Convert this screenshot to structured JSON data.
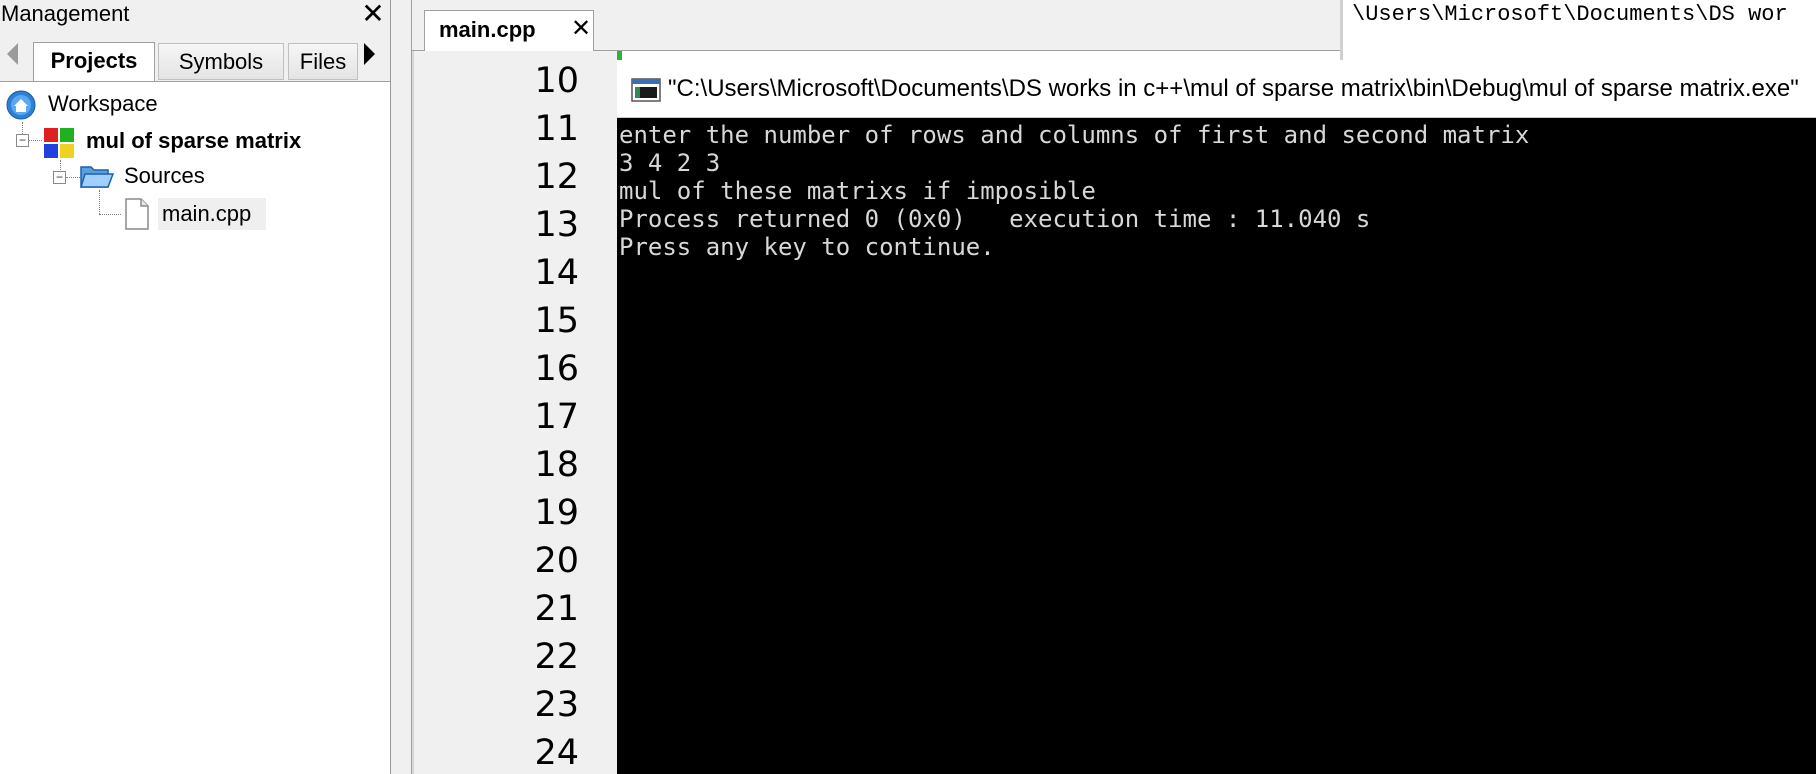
{
  "management": {
    "title": "Management",
    "close_glyph": "✕",
    "tabs": [
      {
        "label": "Projects"
      },
      {
        "label": "Symbols"
      },
      {
        "label": "Files"
      }
    ],
    "tree": {
      "workspace": "Workspace",
      "project": "mul of sparse matrix",
      "folder": "Sources",
      "file": "main.cpp"
    }
  },
  "editor": {
    "tab_label": "main.cpp",
    "tab_close": "✕",
    "line_numbers": [
      "10",
      "11",
      "12",
      "13",
      "14",
      "15",
      "16",
      "17",
      "18",
      "19",
      "20",
      "21",
      "22",
      "23",
      "24"
    ]
  },
  "right_panel": {
    "path_text": "\\Users\\Microsoft\\Documents\\DS wor"
  },
  "console": {
    "title": "\"C:\\Users\\Microsoft\\Documents\\DS works in c++\\mul of sparse matrix\\bin\\Debug\\mul of sparse matrix.exe\"",
    "lines": [
      "enter the number of rows and columns of first and second matrix",
      "3 4 2 3",
      "mul of these matrixs if imposible",
      "Process returned 0 (0x0)   execution time : 11.040 s",
      "Press any key to continue."
    ]
  },
  "colors": {
    "console_bg": "#000000",
    "console_text": "#d8d8d8",
    "gutter_bg": "#f0f0f0",
    "change_bar": "#2fb23b"
  },
  "icons": {
    "workspace": "workspace-globe-icon",
    "project": "project-blocks-icon",
    "folder": "open-folder-icon",
    "file": "file-icon",
    "console": "console-window-icon"
  }
}
